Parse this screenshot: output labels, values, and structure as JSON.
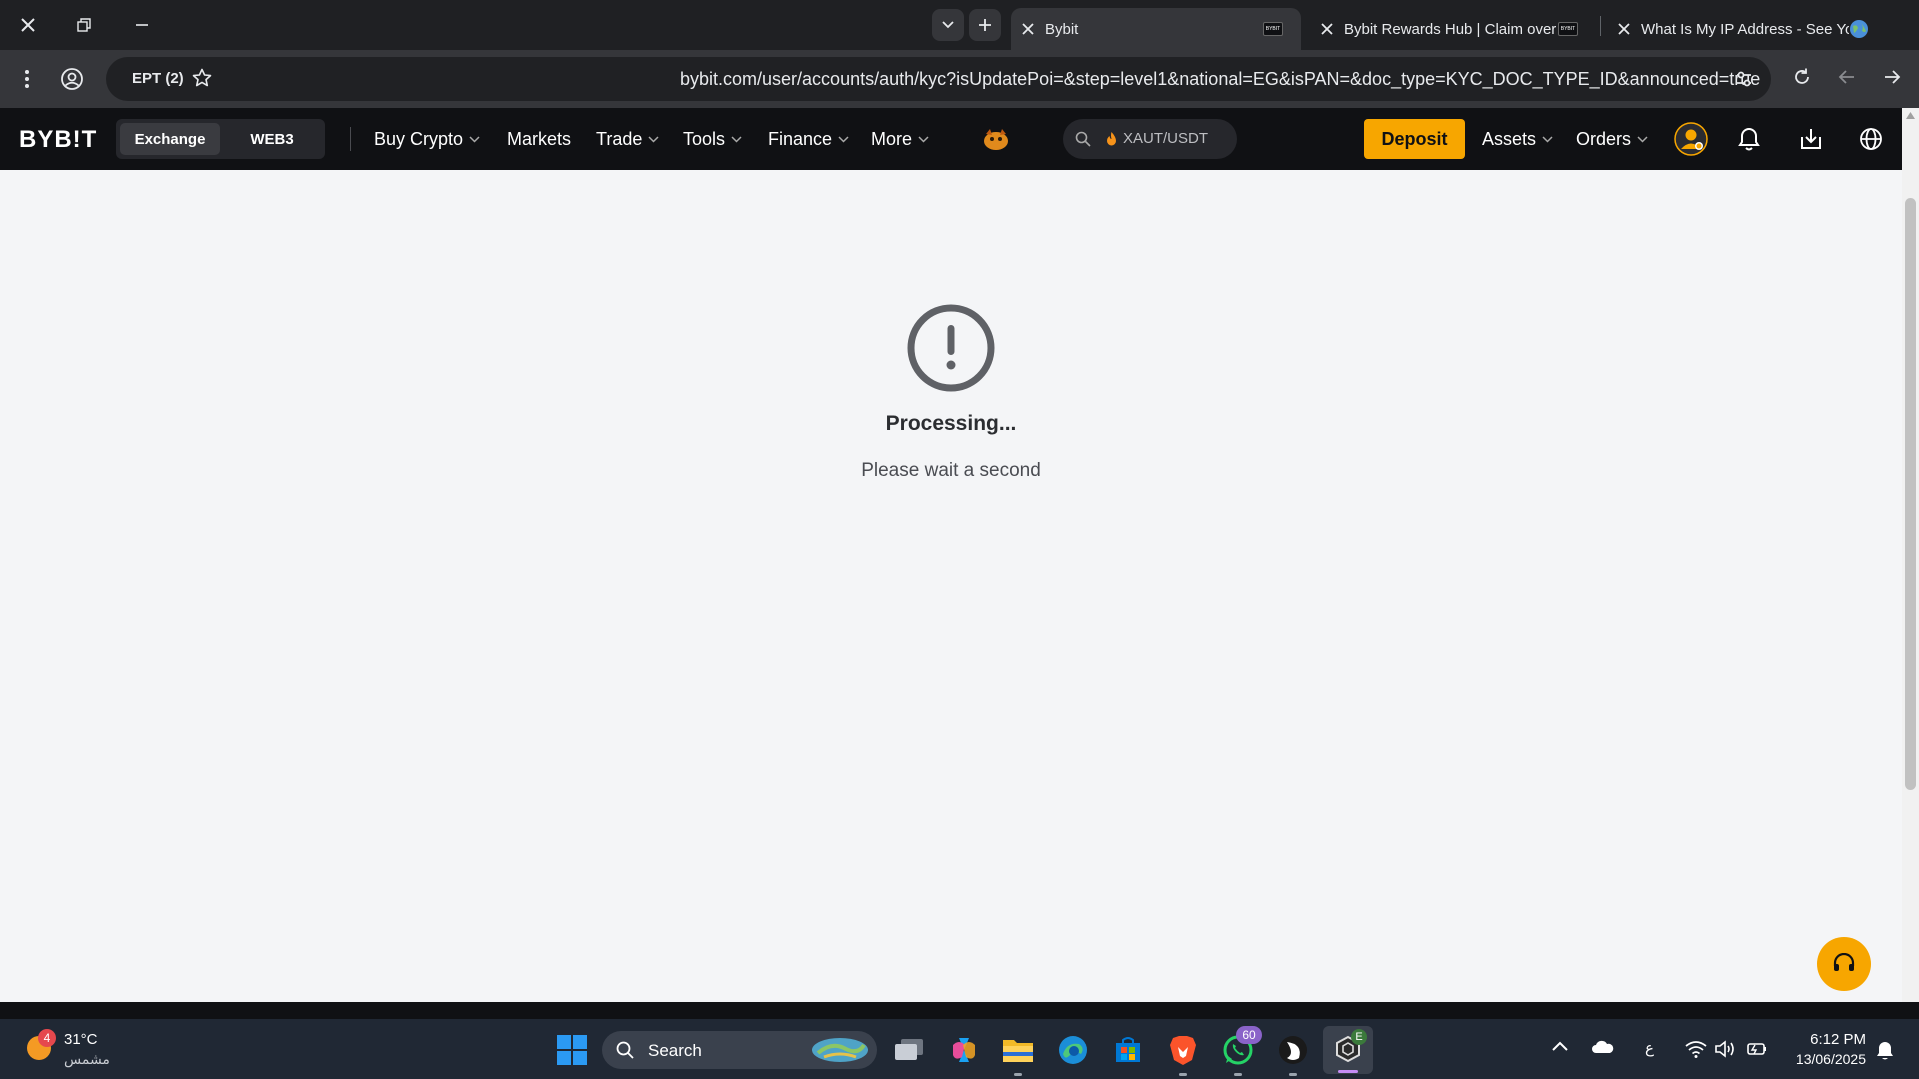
{
  "browser": {
    "tabs": [
      {
        "title": "Bybit",
        "favicon": "BYBIT",
        "active": true
      },
      {
        "title": "Bybit Rewards Hub | Claim over",
        "favicon": "BYBIT",
        "active": false
      },
      {
        "title": "What Is My IP Address - See Yo",
        "favicon": "globe-icon",
        "active": false
      }
    ],
    "profile_label": "EPT (2)",
    "url": "bybit.com/user/accounts/auth/kyc?isUpdatePoi=&step=level1&national=EG&isPAN=&doc_type=KYC_DOC_TYPE_ID&announced=true"
  },
  "header": {
    "logo": "BYB!T",
    "switch": {
      "exchange": "Exchange",
      "web3": "WEB3"
    },
    "nav": [
      {
        "label": "Buy Crypto",
        "dropdown": true
      },
      {
        "label": "Markets",
        "dropdown": false
      },
      {
        "label": "Trade",
        "dropdown": true
      },
      {
        "label": "Tools",
        "dropdown": true
      },
      {
        "label": "Finance",
        "dropdown": true
      },
      {
        "label": "More",
        "dropdown": true
      }
    ],
    "search_pair": "XAUT/USDT",
    "deposit": "Deposit",
    "assets": "Assets",
    "orders": "Orders",
    "accent": "#f7a600"
  },
  "main": {
    "status_icon": "exclamation-circle-icon",
    "title": "Processing...",
    "subtitle": "Please wait a second"
  },
  "taskbar": {
    "weather": {
      "temp": "31°C",
      "desc": "مشمس",
      "badge": "4"
    },
    "search_label": "Search",
    "whatsapp_badge": "60",
    "lang": "ع",
    "time": "6:12 PM",
    "date": "13/06/2025"
  }
}
